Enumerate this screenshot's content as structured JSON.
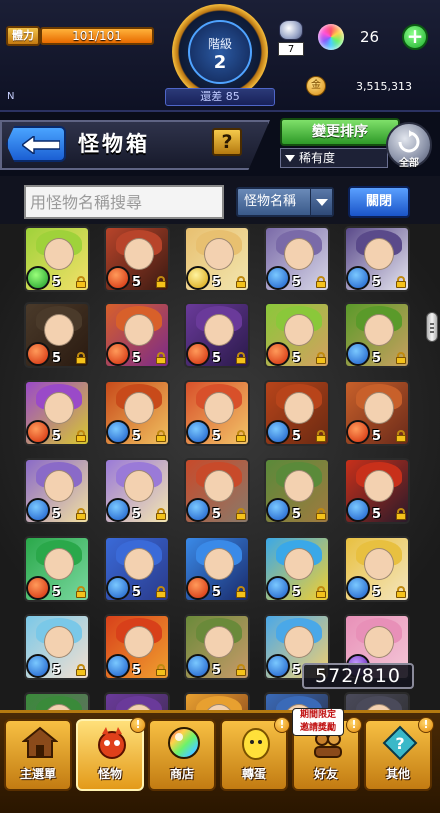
{
  "status": {
    "stamina_label": "體力",
    "stamina_text": "101/101",
    "stamina_fraction": 1.0,
    "rank_label": "階級",
    "rank_value": "2",
    "gap_text": "還差 85",
    "orb_bag_count": "7",
    "orb_amount": "26",
    "plus_label": "+",
    "coin_amount": "3,515,313",
    "n_label": "N"
  },
  "header": {
    "title": "怪物箱",
    "help_label": "?",
    "sort_button_label": "變更排序",
    "sort_select_value": "稀有度",
    "all_label": "全部"
  },
  "search": {
    "placeholder": "用怪物名稱搜尋",
    "field_select_value": "怪物名稱",
    "close_label": "關閉"
  },
  "grid": {
    "box_count": "572/810",
    "colors": {
      "fire": "#d12a0a",
      "water": "#1a5ac8",
      "wood": "#1a9a28",
      "light": "#d6a20a",
      "dark": "#5a1ab0"
    },
    "monsters": [
      {
        "element": "wood",
        "level": "5",
        "art": [
          "#9fd23a",
          "#f3e06a"
        ]
      },
      {
        "element": "fire",
        "level": "5",
        "art": [
          "#b8442a",
          "#3a1a12"
        ]
      },
      {
        "element": "light",
        "level": "5",
        "art": [
          "#e8c070",
          "#f2e6b0"
        ]
      },
      {
        "element": "water",
        "level": "5",
        "art": [
          "#7a6aa8",
          "#d8d8e8"
        ]
      },
      {
        "element": "water",
        "level": "5",
        "art": [
          "#5a4a8a",
          "#e6e6f0"
        ]
      },
      {
        "element": "fire",
        "level": "5",
        "art": [
          "#4a3a2a",
          "#2a1a10"
        ]
      },
      {
        "element": "fire",
        "level": "5",
        "art": [
          "#d8602a",
          "#7a2a8a"
        ]
      },
      {
        "element": "fire",
        "level": "5",
        "art": [
          "#6a3a9a",
          "#2a1a4a"
        ]
      },
      {
        "element": "fire",
        "level": "5",
        "art": [
          "#8ac83a",
          "#d4a060"
        ]
      },
      {
        "element": "water",
        "level": "5",
        "art": [
          "#5a9a2a",
          "#c8a060"
        ]
      },
      {
        "element": "fire",
        "level": "5",
        "art": [
          "#9a4ac8",
          "#d8c830"
        ]
      },
      {
        "element": "water",
        "level": "5",
        "art": [
          "#c84a1a",
          "#f0c060"
        ]
      },
      {
        "element": "water",
        "level": "5",
        "art": [
          "#d8502a",
          "#f2c468"
        ]
      },
      {
        "element": "water",
        "level": "5",
        "art": [
          "#b8441a",
          "#6a2a12"
        ]
      },
      {
        "element": "fire",
        "level": "5",
        "art": [
          "#c8602a",
          "#6a2a1a"
        ]
      },
      {
        "element": "water",
        "level": "5",
        "art": [
          "#8a6ac8",
          "#f2e0a0"
        ]
      },
      {
        "element": "water",
        "level": "5",
        "art": [
          "#9a7ad8",
          "#f4e6b0"
        ]
      },
      {
        "element": "water",
        "level": "5",
        "art": [
          "#c84a2a",
          "#8a7a6a"
        ]
      },
      {
        "element": "water",
        "level": "5",
        "art": [
          "#5a8a3a",
          "#a07a40"
        ]
      },
      {
        "element": "water",
        "level": "5",
        "art": [
          "#c8301a",
          "#2a1a2a"
        ]
      },
      {
        "element": "fire",
        "level": "5",
        "art": [
          "#2aa84a",
          "#7ad8a0"
        ]
      },
      {
        "element": "water",
        "level": "5",
        "art": [
          "#3a6ad8",
          "#2a3a8a"
        ]
      },
      {
        "element": "fire",
        "level": "5",
        "art": [
          "#3a8ae8",
          "#1a2a6a"
        ]
      },
      {
        "element": "water",
        "level": "5",
        "art": [
          "#3aa8e8",
          "#f4d030"
        ]
      },
      {
        "element": "water",
        "level": "5",
        "art": [
          "#e8c040",
          "#f4e6c0"
        ]
      },
      {
        "element": "water",
        "level": "5",
        "art": [
          "#7ac8e8",
          "#f4e0d0"
        ]
      },
      {
        "element": "water",
        "level": "5",
        "art": [
          "#d8401a",
          "#f0a030"
        ]
      },
      {
        "element": "water",
        "level": "5",
        "art": [
          "#6a8a3a",
          "#c89a6a"
        ]
      },
      {
        "element": "water",
        "level": "5",
        "art": [
          "#4aa8e8",
          "#f4d070"
        ]
      },
      {
        "element": "dark",
        "level": "",
        "art": [
          "#e890b8",
          "#f4c8d8"
        ]
      },
      {
        "element": "wood",
        "level": "",
        "art": [
          "#3a8a3a",
          "#6a6a6a"
        ]
      },
      {
        "element": "dark",
        "level": "",
        "art": [
          "#6a3a9a",
          "#3a2a4a"
        ]
      },
      {
        "element": "light",
        "level": "",
        "art": [
          "#e8a030",
          "#7a3a1a"
        ]
      },
      {
        "element": "water",
        "level": "",
        "art": [
          "#3a6ab8",
          "#2a2a3a"
        ]
      },
      {
        "element": "dark",
        "level": "",
        "art": [
          "#4a4a5a",
          "#2a2a2a"
        ]
      }
    ]
  },
  "nav": [
    {
      "label": "主選單",
      "icon": "house-icon",
      "alert": ""
    },
    {
      "label": "怪物",
      "icon": "monster-icon",
      "alert": "!",
      "active": true
    },
    {
      "label": "商店",
      "icon": "rainbow-orb-icon",
      "alert": ""
    },
    {
      "label": "轉蛋",
      "icon": "egg-icon",
      "alert": "!"
    },
    {
      "label": "好友",
      "icon": "friends-icon",
      "alert": "!"
    },
    {
      "label": "其他",
      "icon": "question-box-icon",
      "alert": "!"
    }
  ],
  "limited_tag": "期間限定\n邀請獎勵"
}
